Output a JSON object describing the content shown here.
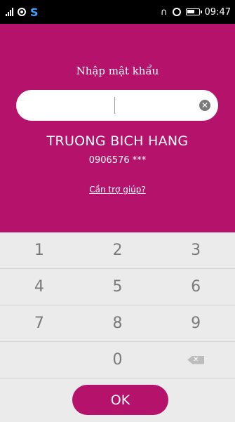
{
  "status_bar": {
    "time": "09:47",
    "icons": [
      "signal-icon",
      "eye-icon",
      "s-app-icon",
      "headphones-icon",
      "alarm-icon",
      "battery-icon"
    ]
  },
  "login": {
    "title": "Nhập mật khẩu",
    "password_value": "",
    "user_name": "TRUONG BICH HANG",
    "phone_masked": "0906576 ***",
    "help_link": "Cần trợ giúp?"
  },
  "keypad": {
    "rows": [
      [
        "1",
        "2",
        "3"
      ],
      [
        "4",
        "5",
        "6"
      ],
      [
        "7",
        "8",
        "9"
      ],
      [
        "",
        "0",
        "backspace"
      ]
    ],
    "ok_label": "OK"
  },
  "colors": {
    "brand": "#b5126b",
    "keypad_bg": "#ebebeb"
  }
}
